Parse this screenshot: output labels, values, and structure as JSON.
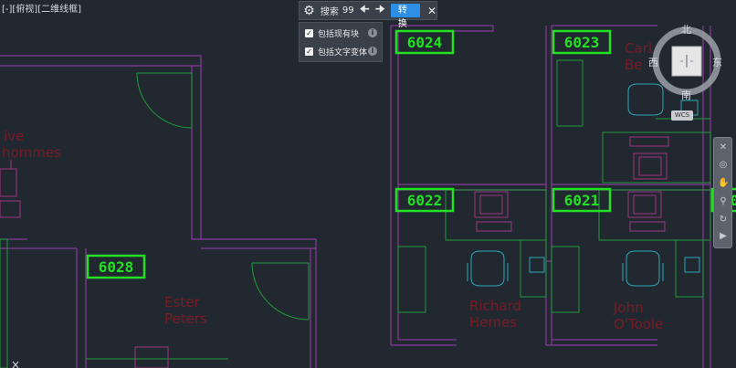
{
  "viewport": {
    "label": "[-][俯视][二维线框]"
  },
  "search": {
    "label": "搜索",
    "count": "99",
    "prev_icon": "arrow-left-icon",
    "next_icon": "arrow-right-icon",
    "convert_label": "转换",
    "close_icon": "close-icon",
    "options": [
      {
        "label": "包括现有块",
        "checked": true
      },
      {
        "label": "包括文字变体",
        "checked": true
      }
    ]
  },
  "viewcube": {
    "north": "北",
    "south": "南",
    "east": "东",
    "west": "西",
    "wcs": "WCS"
  },
  "drawing": {
    "rooms": [
      "6024",
      "6023",
      "6022",
      "6021",
      "6028",
      "60"
    ],
    "occupants": [
      {
        "text": "Ester"
      },
      {
        "text": "Peters"
      },
      {
        "text": "Richard"
      },
      {
        "text": "Hemes"
      },
      {
        "text": "John"
      },
      {
        "text": "O'Toole"
      },
      {
        "text": "Carl"
      },
      {
        "text": "Be"
      },
      {
        "text": "ive"
      },
      {
        "text": "hommes"
      }
    ]
  },
  "colors": {
    "room_tag": "#22e022",
    "wall": "#8a3a9a",
    "furniture_cyan": "#2aa8b8",
    "text_red": "#7a1c26",
    "green_line": "#1f9a3a"
  }
}
